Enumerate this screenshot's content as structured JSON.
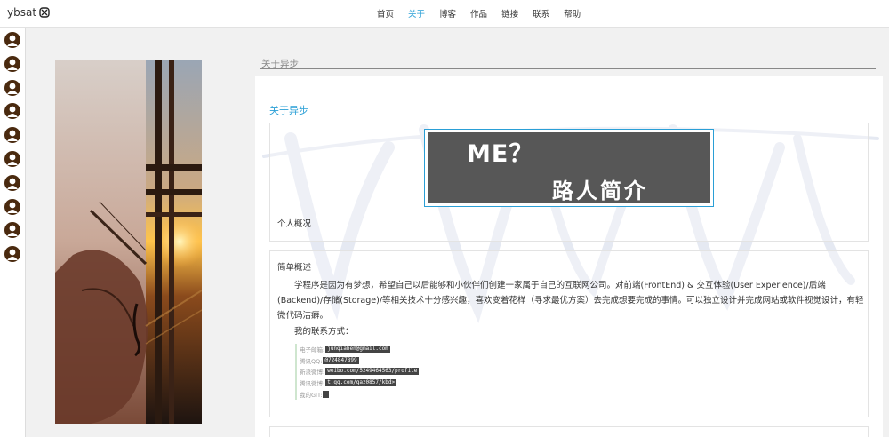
{
  "brand": {
    "text": "ybsat"
  },
  "nav": {
    "items": [
      {
        "label": "首页",
        "active": false
      },
      {
        "label": "关于",
        "active": true
      },
      {
        "label": "博客",
        "active": false
      },
      {
        "label": "作品",
        "active": false
      },
      {
        "label": "链接",
        "active": false
      },
      {
        "label": "联系",
        "active": false
      },
      {
        "label": "帮助",
        "active": false
      }
    ]
  },
  "sidebar": {
    "avatar_count": 10,
    "avatar_icon": "user-avatar-icon"
  },
  "colors": {
    "accent": "#2a9fd6",
    "avatar_bg": "#4a2a0f",
    "banner_bg": "#575757"
  },
  "section": {
    "title": "关于异步"
  },
  "panel": {
    "title": "关于异步",
    "banner": {
      "line1": "ME？",
      "line2": "路人简介"
    },
    "overview_label": "个人概况",
    "summary_title": "简单概述",
    "summary_text": "学程序是因为有梦想，希望自己以后能够和小伙伴们创建一家属于自己的互联网公司。对前端(FrontEnd) & 交互体验(User Experience)/后端(Backend)/存储(Storage)/等相关技术十分感兴趣，喜欢变着花样（寻求最优方案）去完成想要完成的事情。可以独立设计并完成网站或软件视觉设计，有轻微代码洁癖。",
    "contact_heading": "我的联系方式：",
    "contacts": [
      {
        "label": "电子邮箱:",
        "value": "junqiahen@gmail.com"
      },
      {
        "label": "腾讯QQ:",
        "value": "@724847899"
      },
      {
        "label": "新浪微博:",
        "value": "weibo.com/5249464563/profile"
      },
      {
        "label": "腾讯微博:",
        "value": "t.qq.com/qaz0857/kbd>"
      },
      {
        "label": "我的GIT:",
        "value": ""
      }
    ]
  }
}
